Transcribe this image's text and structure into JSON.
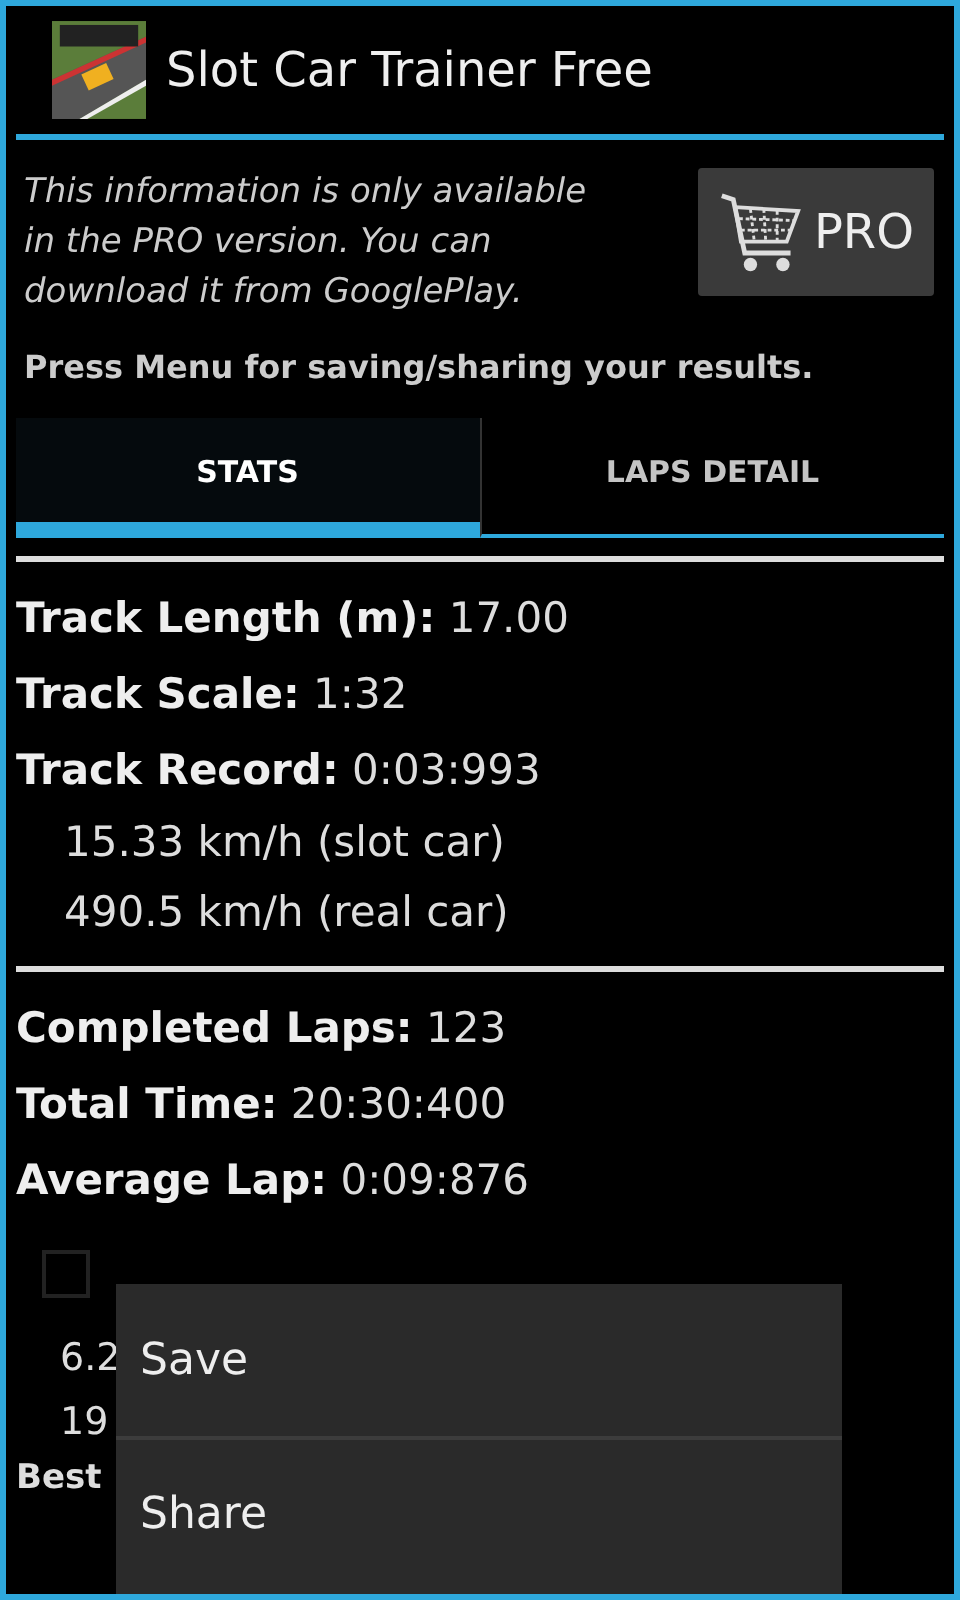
{
  "app_bar": {
    "title": "Slot Car Trainer Free"
  },
  "notice": {
    "text": "This information is only available in the PRO version. You can download it from GooglePlay.",
    "button": "PRO"
  },
  "hint": "Press Menu for saving/sharing your results.",
  "tabs": [
    {
      "label": "STATS",
      "selected": true
    },
    {
      "label": "LAPS DETAIL",
      "selected": false
    }
  ],
  "track_stats": [
    {
      "label": "Track Length (m):",
      "value": "17.00"
    },
    {
      "label": "Track Scale:",
      "value": "1:32"
    },
    {
      "label": "Track Record:",
      "value": "0:03:993"
    }
  ],
  "record_speeds": [
    "15.33 km/h (slot car)",
    "490.5 km/h (real car)"
  ],
  "lap_stats": [
    {
      "label": "Completed Laps:",
      "value": "123"
    },
    {
      "label": "Total Time:",
      "value": "20:30:400"
    },
    {
      "label": "Average Lap:",
      "value": "0:09:876"
    }
  ],
  "option": {
    "checked": false
  },
  "partial_lines": [
    "6.2",
    "19"
  ],
  "partial_label": "Best",
  "menu": [
    {
      "label": "Save"
    },
    {
      "label": "Share"
    }
  ]
}
